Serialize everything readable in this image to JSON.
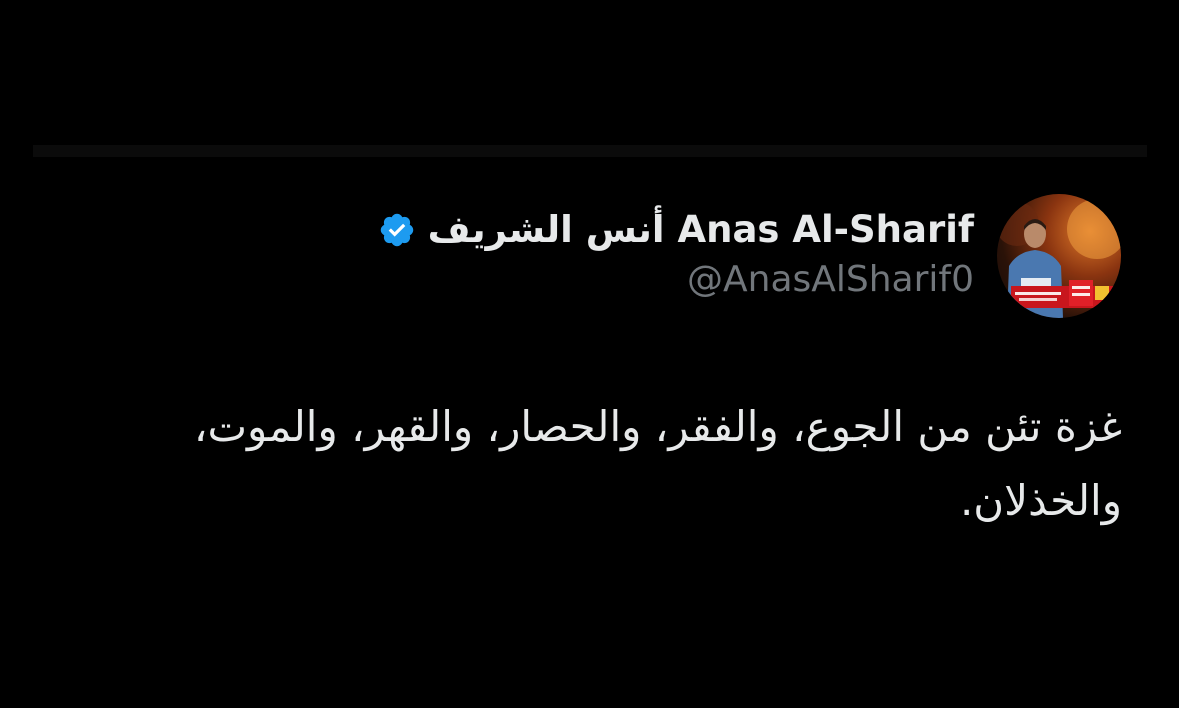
{
  "tweet": {
    "author": {
      "display_name": "أنس الشريف Anas Al-Sharif",
      "handle": "@AnasAlSharif0",
      "verified": true,
      "verified_icon": "verified-badge-icon",
      "avatar_icon": "profile-photo-icon"
    },
    "text": "غزة تئن من الجوع، والفقر، والحصار، والقهر، والموت، والخذلان."
  },
  "colors": {
    "background": "#000000",
    "primary_text": "#e7e9ea",
    "secondary_text": "#71767b",
    "verified_blue": "#1d9bf0"
  }
}
